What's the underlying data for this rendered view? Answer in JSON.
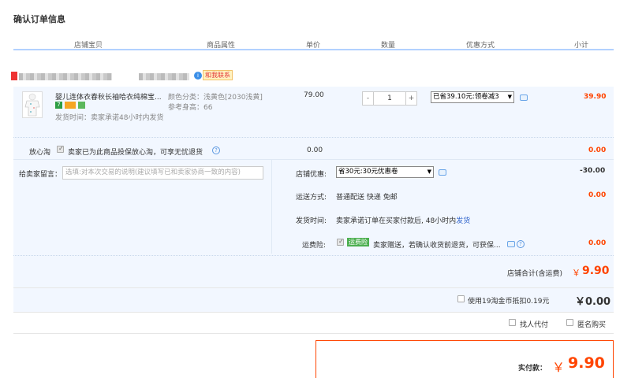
{
  "page_title": "确认订单信息",
  "columns": [
    "店铺宝贝",
    "商品属性",
    "单价",
    "数量",
    "优惠方式",
    "小计"
  ],
  "seller": {
    "contact_label": "和我联系"
  },
  "item": {
    "name": "婴儿连体衣春秋长袖哈衣纯棉宝...",
    "attr_color": "颜色分类：浅黄色[2030浅黄]",
    "attr_height": "参考身高：66",
    "ship_time": "发货时间：卖家承诺48小时内发货",
    "unit_price": "79.00",
    "qty": "1",
    "minus": "-",
    "plus": "+",
    "discount_option": "已省39.10元:领卷减3",
    "subtotal": "39.90"
  },
  "service": {
    "label": "放心淘",
    "desc": "卖家已为此商品投保放心淘，可享无忧退货",
    "price": "0.00",
    "subtotal": "0.00"
  },
  "message": {
    "label": "给卖家留言：",
    "placeholder": "选填:对本次交易的说明(建议填写已和卖家协商一致的内容)"
  },
  "store_discount": {
    "label": "店铺优惠:",
    "option": "省30元:30元优惠卷",
    "value": "-30.00"
  },
  "shipping": {
    "label": "运送方式:",
    "value": "普通配送 快递 免邮",
    "amount": "0.00"
  },
  "ship_time": {
    "label": "发货时间:",
    "value": "卖家承诺订单在买家付款后, 48小时内",
    "link": "发货"
  },
  "freight_insurance": {
    "label": "运费险:",
    "tag": "运费险",
    "desc": "卖家赠送，若确认收货前退货，可获保...",
    "amount": "0.00"
  },
  "store_total": {
    "label": "店铺合计(含运费)",
    "currency": "￥",
    "amount": "9.90"
  },
  "coins": {
    "label": "使用19淘金币抵扣0.19元",
    "amount": "￥0.00"
  },
  "options": {
    "proxy_pay": "找人代付",
    "anonymous": "匿名购买"
  },
  "payment": {
    "label": "实付款：",
    "currency": "￥",
    "amount": "9.90"
  },
  "colors": {
    "accent_orange": "#ff4400",
    "header_line": "#b2d1ff",
    "panel_bg": "#f2f7ff"
  }
}
